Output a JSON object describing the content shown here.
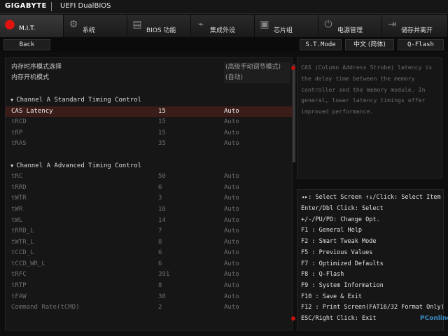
{
  "header": {
    "brand": "GIGABYTE",
    "product": "UEFI DualBIOS"
  },
  "tabs": [
    {
      "label": "M.I.T.",
      "icon": "mit-icon"
    },
    {
      "label": "系统",
      "icon": "gear-icon"
    },
    {
      "label": "BIOS 功能",
      "icon": "bios-icon"
    },
    {
      "label": "集成外设",
      "icon": "peripherals-icon"
    },
    {
      "label": "芯片组",
      "icon": "chipset-icon"
    },
    {
      "label": "电源管理",
      "icon": "power-icon"
    },
    {
      "label": "储存并离开",
      "icon": "exit-icon"
    }
  ],
  "subbar": {
    "back": "Back",
    "st_mode": "S.T.Mode",
    "language": "中文 (简体)",
    "qflash": "Q-Flash"
  },
  "main": {
    "mode_rows": [
      {
        "name": "内存时序模式选择",
        "mode": "(高级手动调节模式)"
      },
      {
        "name": "内存开机模式",
        "mode": "(自动)"
      }
    ],
    "section1": "Channel A Standard Timing Control",
    "standard": [
      {
        "name": "CAS Latency",
        "value": "15",
        "mode": "Auto"
      },
      {
        "name": "tRCD",
        "value": "15",
        "mode": "Auto"
      },
      {
        "name": "tRP",
        "value": "15",
        "mode": "Auto"
      },
      {
        "name": "tRAS",
        "value": "35",
        "mode": "Auto"
      }
    ],
    "section2": "Channel A Advanced Timing Control",
    "advanced": [
      {
        "name": "tRC",
        "value": "50",
        "mode": "Auto"
      },
      {
        "name": "tRRD",
        "value": "6",
        "mode": "Auto"
      },
      {
        "name": "tWTR",
        "value": "3",
        "mode": "Auto"
      },
      {
        "name": "tWR",
        "value": "16",
        "mode": "Auto"
      },
      {
        "name": "tWL",
        "value": "14",
        "mode": "Auto"
      },
      {
        "name": "tRRD_L",
        "value": "7",
        "mode": "Auto"
      },
      {
        "name": "tWTR_L",
        "value": "8",
        "mode": "Auto"
      },
      {
        "name": "tCCD_L",
        "value": "6",
        "mode": "Auto"
      },
      {
        "name": "tCCD_WR_L",
        "value": "6",
        "mode": "Auto"
      },
      {
        "name": "tRFC",
        "value": "391",
        "mode": "Auto"
      },
      {
        "name": "tRTP",
        "value": "8",
        "mode": "Auto"
      },
      {
        "name": "tFAW",
        "value": "30",
        "mode": "Auto"
      },
      {
        "name": "Command Rate(tCMD)",
        "value": "2",
        "mode": "Auto"
      }
    ]
  },
  "help": {
    "text": "CAS (Column Address Strobe) latency is the delay time between the memory controller and the memory module. In general, lower latency timings offer improved performance."
  },
  "keys": [
    "◂▸: Select Screen  ↑↓/Click: Select Item",
    "Enter/Dbl Click: Select",
    "+/-/PU/PD: Change Opt.",
    "F1  : General Help",
    "F2  : Smart Tweak Mode",
    "F5  : Previous Values",
    "F7  : Optimized Defaults",
    "F8  : Q-Flash",
    "F9  : System Information",
    "F10 : Save & Exit",
    "F12 : Print Screen(FAT16/32 Format Only)",
    "ESC/Right Click: Exit"
  ],
  "watermark": "PConline",
  "colors": {
    "accent": "#e0140f",
    "selected_row": "#3a1c18",
    "background": "#0e0e0e"
  }
}
